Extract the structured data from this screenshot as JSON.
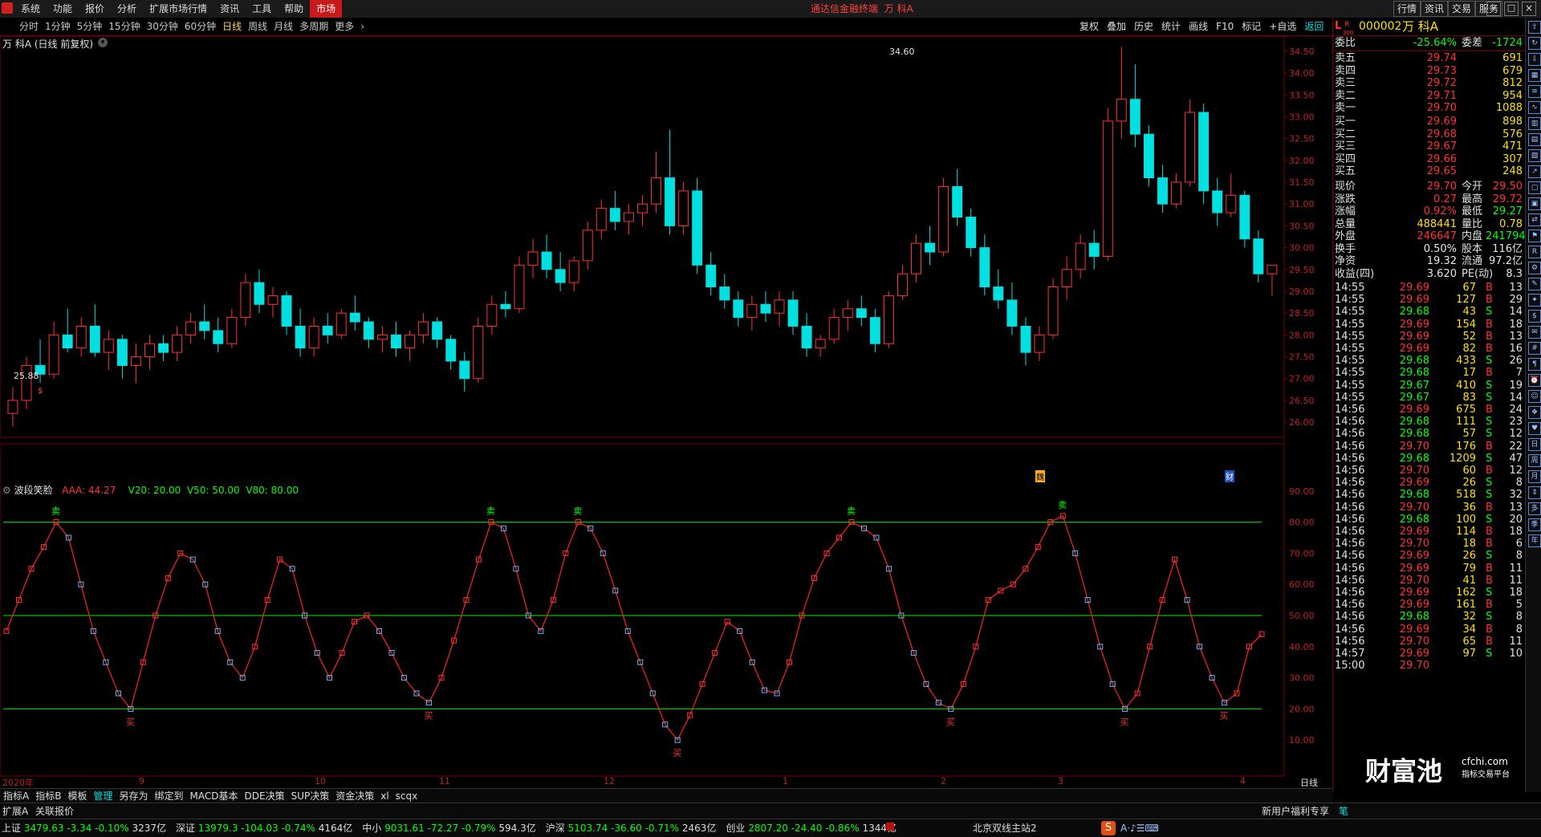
{
  "menubar": {
    "items": [
      "系统",
      "功能",
      "报价",
      "分析",
      "扩展市场行情",
      "资讯",
      "工具",
      "帮助"
    ],
    "market_label": "市场",
    "title": "通达信金融终端",
    "stock_title": "万 科A",
    "right_buttons": [
      "行情",
      "资讯",
      "交易",
      "服务"
    ]
  },
  "periodbar": {
    "items": [
      "分时",
      "1分钟",
      "5分钟",
      "15分钟",
      "30分钟",
      "60分钟",
      "日线",
      "周线",
      "月线",
      "多周期",
      "更多"
    ],
    "active": "日线"
  },
  "toolbar_right": [
    "复权",
    "叠加",
    "历史",
    "统计",
    "画线",
    "F10",
    "标记",
    "+自选",
    "返回"
  ],
  "main_chart": {
    "title": "万 科A (日线 前复权)",
    "high_label": "34.60",
    "low_label": "25.88",
    "marker_left": "$",
    "marker_right_1": "魏",
    "marker_right_2": "财",
    "y_ticks": [
      "34.50",
      "34.00",
      "33.50",
      "33.00",
      "32.50",
      "32.00",
      "31.50",
      "31.00",
      "30.50",
      "30.00",
      "29.50",
      "29.00",
      "28.50",
      "28.00",
      "27.50",
      "27.00",
      "26.50",
      "26.00"
    ]
  },
  "indicator": {
    "name": "波段笑脸",
    "aaa": "AAA: 44.27",
    "v20": "V20: 20.00",
    "v50": "V50: 50.00",
    "v80": "V80: 80.00",
    "y_ticks": [
      "90.00",
      "80.00",
      "70.00",
      "60.00",
      "50.00",
      "40.00",
      "30.00",
      "20.00",
      "10.00"
    ],
    "sell_label": "卖",
    "buy_label": "买"
  },
  "x_axis": {
    "labels": [
      "2020年",
      "9",
      "10",
      "11",
      "12",
      "1",
      "2",
      "3",
      "4"
    ],
    "period_label": "日线"
  },
  "bottom_tabs": [
    "指标A",
    "指标B",
    "模板",
    "管理",
    "另存为",
    "绑定到",
    "MACD基本",
    "DDE决策",
    "SUP决策",
    "资金决策",
    "xl",
    "scqx"
  ],
  "bottom_tabs_active": "管理",
  "quote": {
    "header": {
      "code": "000002",
      "name": "万 科A",
      "l_label": "L",
      "r_label": "R",
      "sub": "300"
    },
    "weibi": {
      "label": "委比",
      "value": "-25.64%",
      "label2": "委差",
      "value2": "-1724"
    },
    "sells": [
      {
        "label": "卖五",
        "price": "29.74",
        "vol": "691"
      },
      {
        "label": "卖四",
        "price": "29.73",
        "vol": "679"
      },
      {
        "label": "卖三",
        "price": "29.72",
        "vol": "812"
      },
      {
        "label": "卖二",
        "price": "29.71",
        "vol": "954"
      },
      {
        "label": "卖一",
        "price": "29.70",
        "vol": "1088"
      }
    ],
    "buys": [
      {
        "label": "买一",
        "price": "29.69",
        "vol": "898"
      },
      {
        "label": "买二",
        "price": "29.68",
        "vol": "576"
      },
      {
        "label": "买三",
        "price": "29.67",
        "vol": "471"
      },
      {
        "label": "买四",
        "price": "29.66",
        "vol": "307"
      },
      {
        "label": "买五",
        "price": "29.65",
        "vol": "248"
      }
    ],
    "stats": [
      {
        "l1": "现价",
        "v1": "29.70",
        "l2": "今开",
        "v2": "29.50"
      },
      {
        "l1": "涨跌",
        "v1": "0.27",
        "l2": "最高",
        "v2": "29.72"
      },
      {
        "l1": "涨幅",
        "v1": "0.92%",
        "l2": "最低",
        "v2": "29.27"
      },
      {
        "l1": "总量",
        "v1": "488441",
        "l2": "量比",
        "v2": "0.78"
      },
      {
        "l1": "外盘",
        "v1": "246647",
        "l2": "内盘",
        "v2": "241794"
      },
      {
        "l1": "换手",
        "v1": "0.50%",
        "l2": "股本",
        "v2": "116亿"
      },
      {
        "l1": "净资",
        "v1": "19.32",
        "l2": "流通",
        "v2": "97.2亿"
      },
      {
        "l1": "收益(四)",
        "v1": "3.620",
        "l2": "PE(动)",
        "v2": "8.3"
      }
    ],
    "ticks": [
      {
        "t": "14:55",
        "p": "29.69",
        "v": "67",
        "bs": "B",
        "n": "13"
      },
      {
        "t": "14:55",
        "p": "29.69",
        "v": "127",
        "bs": "B",
        "n": "29"
      },
      {
        "t": "14:55",
        "p": "29.68",
        "v": "43",
        "bs": "S",
        "n": "14"
      },
      {
        "t": "14:55",
        "p": "29.69",
        "v": "154",
        "bs": "B",
        "n": "18"
      },
      {
        "t": "14:55",
        "p": "29.69",
        "v": "52",
        "bs": "B",
        "n": "13"
      },
      {
        "t": "14:55",
        "p": "29.69",
        "v": "82",
        "bs": "B",
        "n": "16"
      },
      {
        "t": "14:55",
        "p": "29.68",
        "v": "433",
        "bs": "S",
        "n": "26"
      },
      {
        "t": "14:55",
        "p": "29.68",
        "v": "17",
        "bs": "B",
        "n": "7"
      },
      {
        "t": "14:55",
        "p": "29.67",
        "v": "410",
        "bs": "S",
        "n": "19"
      },
      {
        "t": "14:55",
        "p": "29.67",
        "v": "83",
        "bs": "S",
        "n": "14"
      },
      {
        "t": "14:56",
        "p": "29.69",
        "v": "675",
        "bs": "B",
        "n": "24"
      },
      {
        "t": "14:56",
        "p": "29.68",
        "v": "111",
        "bs": "S",
        "n": "23"
      },
      {
        "t": "14:56",
        "p": "29.68",
        "v": "57",
        "bs": "S",
        "n": "12"
      },
      {
        "t": "14:56",
        "p": "29.70",
        "v": "176",
        "bs": "B",
        "n": "22"
      },
      {
        "t": "14:56",
        "p": "29.68",
        "v": "1209",
        "bs": "S",
        "n": "47"
      },
      {
        "t": "14:56",
        "p": "29.70",
        "v": "60",
        "bs": "B",
        "n": "12"
      },
      {
        "t": "14:56",
        "p": "29.69",
        "v": "26",
        "bs": "S",
        "n": "8"
      },
      {
        "t": "14:56",
        "p": "29.68",
        "v": "518",
        "bs": "S",
        "n": "32"
      },
      {
        "t": "14:56",
        "p": "29.70",
        "v": "36",
        "bs": "B",
        "n": "13"
      },
      {
        "t": "14:56",
        "p": "29.68",
        "v": "100",
        "bs": "S",
        "n": "20"
      },
      {
        "t": "14:56",
        "p": "29.69",
        "v": "114",
        "bs": "B",
        "n": "18"
      },
      {
        "t": "14:56",
        "p": "29.70",
        "v": "18",
        "bs": "B",
        "n": "6"
      },
      {
        "t": "14:56",
        "p": "29.69",
        "v": "26",
        "bs": "S",
        "n": "8"
      },
      {
        "t": "14:56",
        "p": "29.69",
        "v": "79",
        "bs": "B",
        "n": "11"
      },
      {
        "t": "14:56",
        "p": "29.70",
        "v": "41",
        "bs": "B",
        "n": "11"
      },
      {
        "t": "14:56",
        "p": "29.69",
        "v": "162",
        "bs": "S",
        "n": "18"
      },
      {
        "t": "14:56",
        "p": "29.69",
        "v": "161",
        "bs": "B",
        "n": "5"
      },
      {
        "t": "14:56",
        "p": "29.68",
        "v": "32",
        "bs": "S",
        "n": "8"
      },
      {
        "t": "14:56",
        "p": "29.69",
        "v": "34",
        "bs": "B",
        "n": "8"
      },
      {
        "t": "14:56",
        "p": "29.70",
        "v": "65",
        "bs": "B",
        "n": "11"
      },
      {
        "t": "14:57",
        "p": "29.69",
        "v": "97",
        "bs": "S",
        "n": "10"
      },
      {
        "t": "15:00",
        "p": "29.70",
        "v": "",
        "bs": "",
        "n": ""
      }
    ],
    "brand": "财富池",
    "brand_site": "cfchi.com",
    "brand_sub": "指标交易平台"
  },
  "statusbar1": {
    "left": "扩展A",
    "left2": "关联报价",
    "right": "新用户福利专享",
    "right2": "笔"
  },
  "statusbar2": {
    "indices": [
      {
        "name": "上证",
        "value": "3479.63",
        "chg": "-3.34",
        "pct": "-0.10%",
        "amt": "3237亿"
      },
      {
        "name": "深证",
        "value": "13979.3",
        "chg": "-104.03",
        "pct": "-0.74%",
        "amt": "4164亿"
      },
      {
        "name": "中小",
        "value": "9031.61",
        "chg": "-72.27",
        "pct": "-0.79%",
        "amt": "594.3亿"
      },
      {
        "name": "沪深",
        "value": "5103.74",
        "chg": "-36.60",
        "pct": "-0.71%",
        "amt": "2463亿"
      },
      {
        "name": "创业",
        "value": "2807.20",
        "chg": "-24.40",
        "pct": "-0.86%",
        "amt": "1344亿"
      }
    ],
    "server": "北京双线主站2"
  },
  "colors": {
    "up": "#ff3232",
    "down": "#00e0e0",
    "grid": "#7a0000",
    "line_band": "#00c000"
  },
  "chart_data": [
    {
      "type": "candlestick",
      "title": "万 科A (日线 前复权)",
      "y_range": [
        25.8,
        34.7
      ],
      "annotations": {
        "max": "34.60",
        "min": "25.88"
      },
      "candles": [
        [
          26.2,
          26.8,
          25.9,
          26.5
        ],
        [
          26.5,
          27.5,
          26.3,
          27.3
        ],
        [
          27.3,
          27.9,
          26.9,
          27.1
        ],
        [
          27.1,
          28.3,
          27.0,
          28.0
        ],
        [
          28.0,
          28.6,
          27.6,
          27.7
        ],
        [
          27.7,
          28.4,
          27.5,
          28.2
        ],
        [
          28.2,
          28.7,
          27.5,
          27.6
        ],
        [
          27.6,
          28.1,
          27.2,
          27.9
        ],
        [
          27.9,
          28.0,
          27.0,
          27.3
        ],
        [
          27.3,
          27.8,
          26.9,
          27.5
        ],
        [
          27.5,
          28.0,
          27.2,
          27.8
        ],
        [
          27.8,
          28.0,
          27.4,
          27.6
        ],
        [
          27.6,
          28.2,
          27.4,
          28.0
        ],
        [
          28.0,
          28.5,
          27.8,
          28.3
        ],
        [
          28.3,
          28.7,
          27.9,
          28.1
        ],
        [
          28.1,
          28.4,
          27.6,
          27.8
        ],
        [
          27.8,
          28.6,
          27.7,
          28.4
        ],
        [
          28.4,
          29.4,
          28.2,
          29.2
        ],
        [
          29.2,
          29.5,
          28.5,
          28.7
        ],
        [
          28.7,
          29.1,
          28.4,
          28.9
        ],
        [
          28.9,
          29.0,
          28.0,
          28.2
        ],
        [
          28.2,
          28.6,
          27.5,
          27.7
        ],
        [
          27.7,
          28.4,
          27.5,
          28.2
        ],
        [
          28.2,
          28.5,
          27.8,
          28.0
        ],
        [
          28.0,
          28.6,
          27.9,
          28.5
        ],
        [
          28.5,
          28.9,
          28.1,
          28.3
        ],
        [
          28.3,
          28.4,
          27.7,
          27.9
        ],
        [
          27.9,
          28.2,
          27.6,
          28.0
        ],
        [
          28.0,
          28.3,
          27.5,
          27.7
        ],
        [
          27.7,
          28.1,
          27.4,
          28.0
        ],
        [
          28.0,
          28.5,
          27.8,
          28.3
        ],
        [
          28.3,
          28.4,
          27.7,
          27.9
        ],
        [
          27.9,
          28.0,
          27.2,
          27.4
        ],
        [
          27.4,
          27.6,
          26.7,
          27.0
        ],
        [
          27.0,
          28.4,
          26.9,
          28.2
        ],
        [
          28.2,
          28.9,
          28.0,
          28.7
        ],
        [
          28.7,
          29.0,
          28.4,
          28.6
        ],
        [
          28.6,
          29.8,
          28.5,
          29.6
        ],
        [
          29.6,
          30.2,
          29.3,
          29.9
        ],
        [
          29.9,
          30.3,
          29.3,
          29.5
        ],
        [
          29.5,
          29.9,
          29.0,
          29.2
        ],
        [
          29.2,
          29.8,
          29.0,
          29.7
        ],
        [
          29.7,
          30.6,
          29.5,
          30.4
        ],
        [
          30.4,
          31.1,
          30.2,
          30.9
        ],
        [
          30.9,
          31.3,
          30.4,
          30.6
        ],
        [
          30.6,
          31.0,
          30.3,
          30.8
        ],
        [
          30.8,
          31.2,
          30.5,
          31.0
        ],
        [
          31.0,
          32.2,
          30.8,
          31.6
        ],
        [
          31.6,
          32.7,
          30.3,
          30.5
        ],
        [
          30.5,
          31.5,
          30.3,
          31.3
        ],
        [
          31.3,
          31.6,
          29.4,
          29.6
        ],
        [
          29.6,
          29.9,
          28.9,
          29.1
        ],
        [
          29.1,
          29.4,
          28.6,
          28.8
        ],
        [
          28.8,
          29.0,
          28.2,
          28.4
        ],
        [
          28.4,
          28.9,
          28.1,
          28.7
        ],
        [
          28.7,
          29.0,
          28.3,
          28.5
        ],
        [
          28.5,
          29.0,
          28.2,
          28.8
        ],
        [
          28.8,
          29.0,
          28.0,
          28.2
        ],
        [
          28.2,
          28.5,
          27.5,
          27.7
        ],
        [
          27.7,
          28.0,
          27.5,
          27.9
        ],
        [
          27.9,
          28.6,
          27.8,
          28.4
        ],
        [
          28.4,
          28.8,
          28.1,
          28.6
        ],
        [
          28.6,
          28.9,
          28.2,
          28.4
        ],
        [
          28.4,
          28.6,
          27.6,
          27.8
        ],
        [
          27.8,
          29.0,
          27.7,
          28.9
        ],
        [
          28.9,
          29.6,
          28.8,
          29.4
        ],
        [
          29.4,
          30.3,
          29.2,
          30.1
        ],
        [
          30.1,
          30.5,
          29.6,
          29.9
        ],
        [
          29.9,
          31.6,
          29.8,
          31.4
        ],
        [
          31.4,
          31.8,
          30.5,
          30.7
        ],
        [
          30.7,
          30.9,
          29.8,
          30.0
        ],
        [
          30.0,
          30.3,
          28.9,
          29.1
        ],
        [
          29.1,
          29.5,
          28.6,
          28.8
        ],
        [
          28.8,
          29.2,
          28.0,
          28.2
        ],
        [
          28.2,
          28.4,
          27.3,
          27.6
        ],
        [
          27.6,
          28.2,
          27.4,
          28.0
        ],
        [
          28.0,
          29.3,
          27.9,
          29.1
        ],
        [
          29.1,
          29.8,
          28.8,
          29.5
        ],
        [
          29.5,
          30.3,
          29.3,
          30.1
        ],
        [
          30.1,
          30.4,
          29.5,
          29.8
        ],
        [
          29.8,
          33.2,
          29.7,
          32.9
        ],
        [
          32.9,
          34.6,
          32.5,
          33.4
        ],
        [
          33.4,
          34.2,
          32.3,
          32.6
        ],
        [
          32.6,
          32.8,
          31.4,
          31.6
        ],
        [
          31.6,
          31.9,
          30.8,
          31.0
        ],
        [
          31.0,
          31.7,
          30.9,
          31.5
        ],
        [
          31.5,
          33.4,
          31.4,
          33.1
        ],
        [
          33.1,
          33.3,
          31.0,
          31.3
        ],
        [
          31.3,
          31.6,
          30.5,
          30.8
        ],
        [
          30.8,
          31.7,
          30.7,
          31.2
        ],
        [
          31.2,
          31.3,
          30.0,
          30.2
        ],
        [
          30.2,
          30.4,
          29.2,
          29.4
        ],
        [
          29.4,
          29.6,
          28.9,
          29.6
        ]
      ]
    },
    {
      "type": "line",
      "title": "波段笑脸",
      "y_range": [
        0,
        100
      ],
      "reference_lines": [
        20,
        50,
        80
      ],
      "series": [
        {
          "name": "AAA",
          "values": [
            45,
            55,
            65,
            72,
            80,
            75,
            60,
            45,
            35,
            25,
            20,
            35,
            50,
            62,
            70,
            68,
            60,
            45,
            35,
            30,
            40,
            55,
            68,
            65,
            50,
            38,
            30,
            38,
            48,
            50,
            45,
            38,
            30,
            25,
            22,
            30,
            42,
            55,
            68,
            80,
            78,
            65,
            50,
            45,
            55,
            70,
            80,
            78,
            70,
            58,
            45,
            35,
            25,
            15,
            10,
            18,
            28,
            38,
            48,
            45,
            35,
            26,
            25,
            35,
            50,
            62,
            70,
            75,
            80,
            78,
            75,
            65,
            50,
            38,
            28,
            22,
            20,
            28,
            40,
            55,
            58,
            60,
            65,
            72,
            80,
            82,
            70,
            55,
            40,
            28,
            20,
            25,
            40,
            55,
            68,
            55,
            40,
            30,
            22,
            25,
            40,
            44
          ]
        }
      ]
    }
  ]
}
